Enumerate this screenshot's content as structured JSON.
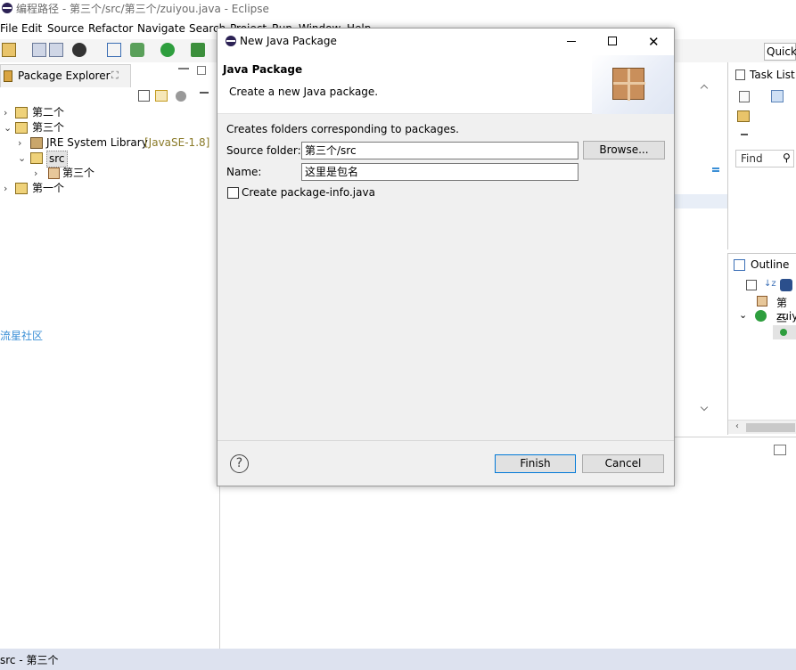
{
  "window": {
    "title": "编程路径 - 第三个/src/第三个/zuiyou.java - Eclipse"
  },
  "menu": [
    "File",
    "Edit",
    "Source",
    "Refactor",
    "Navigate",
    "Search",
    "Project",
    "Run",
    "Window",
    "Help"
  ],
  "quick_access": "Quick",
  "package_explorer": {
    "tab": "Package Explorer",
    "tab_suffix": "⛶",
    "tree": [
      {
        "label": "第二个",
        "suffix": ""
      },
      {
        "label": "第三个",
        "suffix": ""
      },
      {
        "label": "JRE System Library",
        "suffix": "[JavaSE-1.8]"
      },
      {
        "label": "src",
        "suffix": ""
      },
      {
        "label": "第三个",
        "suffix": ""
      },
      {
        "label": "第一个",
        "suffix": ""
      }
    ],
    "watermark": "流星社区"
  },
  "task_list": {
    "tab": "Task List",
    "find_placeholder": "Find"
  },
  "outline": {
    "tab": "Outline",
    "items": [
      "第三",
      "zuiy"
    ]
  },
  "status_bar": {
    "text": "src - 第三个"
  },
  "dialog": {
    "title": "New Java Package",
    "heading": "Java Package",
    "subheading": "Create a new Java package.",
    "description": "Creates folders corresponding to packages.",
    "source_folder_label": "Source folder:",
    "source_folder_value": "第三个/src",
    "browse_label": "Browse...",
    "name_label": "Name:",
    "name_value": "这里是包名",
    "checkbox_label": "Create package-info.java",
    "checkbox_checked": false,
    "help_label": "?",
    "finish_label": "Finish",
    "cancel_label": "Cancel"
  }
}
